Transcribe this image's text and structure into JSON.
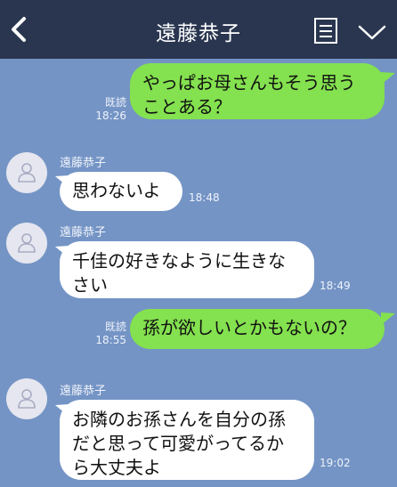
{
  "header": {
    "title": "遠藤恭子",
    "icons": {
      "back": "chevron-left-icon",
      "notes": "notes-icon",
      "menu": "chevron-down-icon"
    }
  },
  "colors": {
    "header_bg": "#2a3650",
    "chat_bg": "#7494c5",
    "outgoing_bubble": "#84e14f",
    "incoming_bubble": "#ffffff",
    "avatar_bg": "#e5e6ef"
  },
  "messages": [
    {
      "direction": "out",
      "text": "やっぱお母さんもそう思う\nことある？",
      "read": "既読",
      "time": "18:26"
    },
    {
      "direction": "in",
      "sender": "遠藤恭子",
      "text": "思わないよ",
      "time": "18:48"
    },
    {
      "direction": "in",
      "sender": "遠藤恭子",
      "text": "千佳の好きなように生きな\nさい",
      "time": "18:49"
    },
    {
      "direction": "out",
      "text": "孫が欲しいとかもないの？",
      "read": "既読",
      "time": "18:55"
    },
    {
      "direction": "in",
      "sender": "遠藤恭子",
      "text": "お隣のお孫さんを自分の孫\nだと思って可愛がってるか\nら大丈夫よ",
      "time": "19:02"
    }
  ]
}
